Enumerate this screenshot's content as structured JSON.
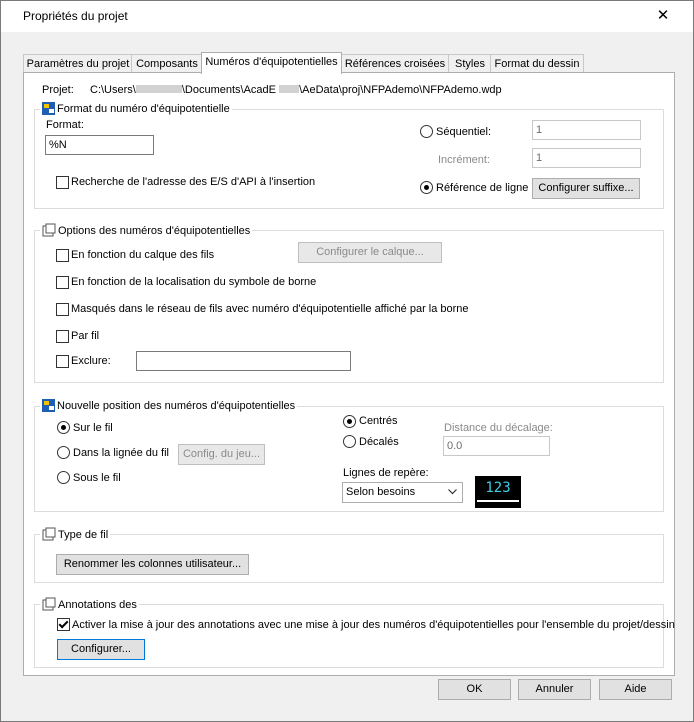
{
  "window": {
    "title": "Propriétés du projet",
    "close_glyph": "✕"
  },
  "tabs": [
    {
      "label": "Paramètres du projet"
    },
    {
      "label": "Composants"
    },
    {
      "label": "Numéros d'équipotentielles"
    },
    {
      "label": "Références croisées"
    },
    {
      "label": "Styles"
    },
    {
      "label": "Format du dessin"
    }
  ],
  "project": {
    "label": "Projet:",
    "path_prefix": "C:\\Users\\",
    "path_mid": "\\Documents\\AcadE ",
    "path_suffix": "\\AeData\\proj\\NFPAdemo\\NFPAdemo.wdp"
  },
  "format_group": {
    "title": "Format du numéro d'équipotentielle",
    "format_label": "Format:",
    "format_value": "%N",
    "search_io_label": "Recherche de l'adresse des E/S d'API à l'insertion",
    "search_io_checked": false,
    "sequential_label": "Séquentiel:",
    "sequential_value": "1",
    "increment_label": "Incrément:",
    "increment_value": "1",
    "line_ref_label": "Référence de ligne",
    "mode_selected": "Référence de ligne",
    "configure_suffix_label": "Configurer suffixe..."
  },
  "options_group": {
    "title": "Options des numéros d'équipotentielles",
    "wire_layer_label": "En fonction du calque des fils",
    "configure_layer_label": "Configurer le calque...",
    "terminal_location_label": "En fonction de la localisation du symbole de borne",
    "hidden_network_label": "Masqués dans le réseau de fils avec numéro d'équipotentielle affiché par la borne",
    "per_wire_label": "Par fil",
    "exclude_label": "Exclure:",
    "exclude_value": ""
  },
  "position_group": {
    "title": "Nouvelle position des numéros d'équipotentielles",
    "on_wire_label": "Sur le fil",
    "in_line_label": "Dans la lignée du fil",
    "config_gap_label": "Config. du jeu...",
    "below_wire_label": "Sous le fil",
    "placement_selected": "Sur le fil",
    "centered_label": "Centrés",
    "offset_label": "Décalés",
    "alignment_selected": "Centrés",
    "offset_distance_label": "Distance du décalage:",
    "offset_distance_value": "0.0",
    "leader_label": "Lignes de repère:",
    "leader_value": "Selon besoins",
    "preview_text": "123"
  },
  "wire_type_group": {
    "title": "Type de fil",
    "rename_columns_label": "Renommer les colonnes utilisateur..."
  },
  "annotations_group": {
    "title": "Annotations des",
    "update_label": "Activer la mise à jour des annotations avec une mise à jour des numéros d'équipotentielles pour l'ensemble du projet/dessin",
    "update_checked": true,
    "configure_label": "Configurer..."
  },
  "footer": {
    "ok_label": "OK",
    "cancel_label": "Annuler",
    "help_label": "Aide"
  }
}
